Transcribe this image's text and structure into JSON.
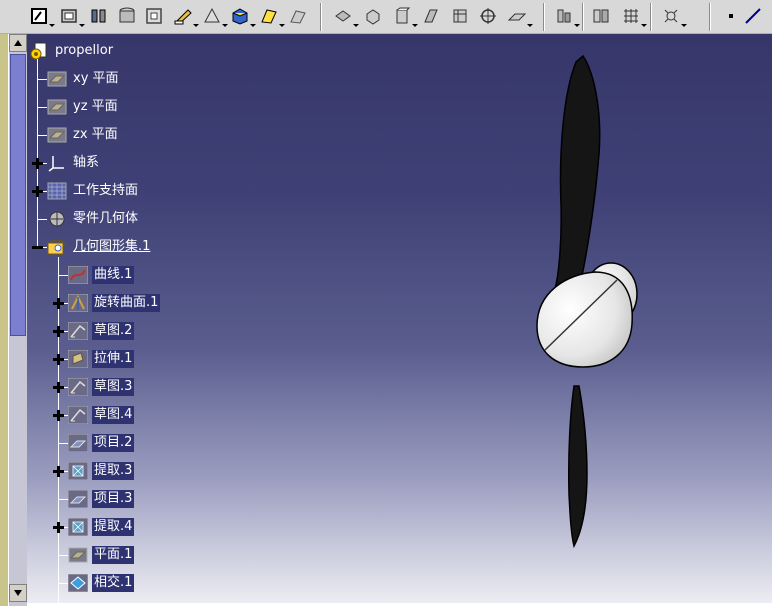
{
  "toolbar": {
    "buttons": [
      {
        "name": "sketch-icon",
        "has_dropdown": true
      },
      {
        "name": "plane-icon",
        "has_dropdown": true
      },
      {
        "name": "axis-icon",
        "has_dropdown": false
      },
      {
        "name": "cylinder-icon",
        "has_dropdown": false
      },
      {
        "name": "square-icon",
        "has_dropdown": false
      },
      {
        "name": "pencil-edit-icon",
        "has_dropdown": true
      },
      {
        "name": "shape-icon",
        "has_dropdown": true
      },
      {
        "name": "cube-color-icon",
        "has_dropdown": true
      },
      {
        "name": "surface-yellow-icon",
        "has_dropdown": true
      },
      {
        "name": "surface-gray-icon",
        "has_dropdown": false
      },
      {
        "name": "boolean-icon",
        "has_dropdown": true
      },
      {
        "name": "solid-icon",
        "has_dropdown": false
      },
      {
        "name": "extrude-icon",
        "has_dropdown": true
      },
      {
        "name": "sweep-icon",
        "has_dropdown": false
      },
      {
        "name": "box-icon",
        "has_dropdown": false
      },
      {
        "name": "target-icon",
        "has_dropdown": false
      },
      {
        "name": "flat-icon",
        "has_dropdown": true
      },
      {
        "name": "transform-icon",
        "has_dropdown": true
      },
      {
        "name": "measure-icon",
        "has_dropdown": false
      },
      {
        "name": "grid-icon",
        "has_dropdown": true
      },
      {
        "name": "analysis-icon",
        "has_dropdown": true
      },
      {
        "name": "point-icon",
        "has_dropdown": false
      },
      {
        "name": "line-icon",
        "has_dropdown": false
      }
    ]
  },
  "tree": {
    "root": {
      "label": "propellor"
    },
    "items": [
      {
        "label": "xy 平面",
        "icon": "plane-icon",
        "level": 1,
        "expander": "none",
        "highlight": false
      },
      {
        "label": "yz 平面",
        "icon": "plane-icon",
        "level": 1,
        "expander": "none",
        "highlight": false
      },
      {
        "label": "zx 平面",
        "icon": "plane-icon",
        "level": 1,
        "expander": "none",
        "highlight": false
      },
      {
        "label": "轴系",
        "icon": "axis-system-icon",
        "level": 1,
        "expander": "plus",
        "highlight": false
      },
      {
        "label": "工作支持面",
        "icon": "work-support-icon",
        "level": 1,
        "expander": "plus",
        "highlight": false
      },
      {
        "label": "零件几何体",
        "icon": "part-body-icon",
        "level": 1,
        "expander": "none",
        "highlight": false
      },
      {
        "label": "几何图形集.1",
        "icon": "geometric-set-icon",
        "level": 1,
        "expander": "minus",
        "highlight": false,
        "active": true
      },
      {
        "label": "曲线.1",
        "icon": "curve-icon",
        "level": 2,
        "expander": "none",
        "highlight": true
      },
      {
        "label": "旋转曲面.1",
        "icon": "revolve-surface-icon",
        "level": 2,
        "expander": "plus",
        "highlight": true
      },
      {
        "label": "草图.2",
        "icon": "sketch-icon",
        "level": 2,
        "expander": "plus",
        "highlight": true
      },
      {
        "label": "拉伸.1",
        "icon": "extrude-icon",
        "level": 2,
        "expander": "plus",
        "highlight": true
      },
      {
        "label": "草图.3",
        "icon": "sketch-icon",
        "level": 2,
        "expander": "plus",
        "highlight": true
      },
      {
        "label": "草图.4",
        "icon": "sketch-icon",
        "level": 2,
        "expander": "plus",
        "highlight": true
      },
      {
        "label": "项目.2",
        "icon": "projection-icon",
        "level": 2,
        "expander": "none",
        "highlight": true
      },
      {
        "label": "提取.3",
        "icon": "extract-icon",
        "level": 2,
        "expander": "plus",
        "highlight": true
      },
      {
        "label": "项目.3",
        "icon": "projection-icon",
        "level": 2,
        "expander": "none",
        "highlight": true
      },
      {
        "label": "提取.4",
        "icon": "extract-icon",
        "level": 2,
        "expander": "plus",
        "highlight": true
      },
      {
        "label": "平面.1",
        "icon": "plane-icon",
        "level": 2,
        "expander": "none",
        "highlight": true
      },
      {
        "label": "相交.1",
        "icon": "intersect-icon",
        "level": 2,
        "expander": "none",
        "highlight": true
      }
    ]
  },
  "colors": {
    "toolbar_bg": "#d8d8d8",
    "tree_text": "#ffffff",
    "tree_highlight": "#2e3270",
    "scroll_thumb": "#7c7ed0",
    "left_strip": "#c8c48a"
  }
}
